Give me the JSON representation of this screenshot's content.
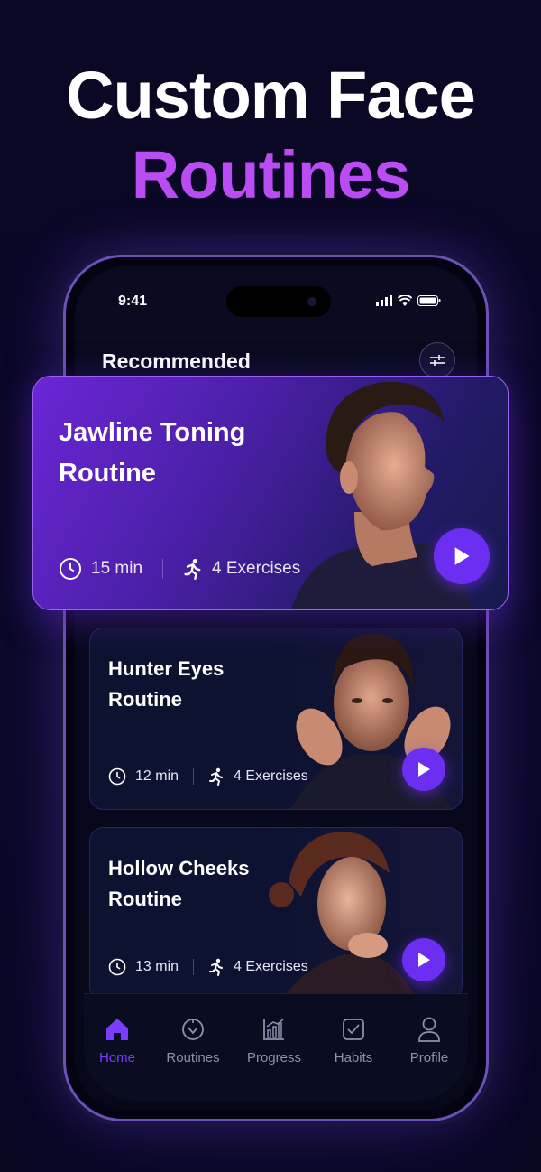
{
  "headline": {
    "line1": "Custom Face",
    "line2": "Routines"
  },
  "status_bar": {
    "time": "9:41"
  },
  "section": {
    "title": "Recommended"
  },
  "routines": [
    {
      "title": "Jawline Toning Routine",
      "duration": "15 min",
      "exercises": "4 Exercises"
    },
    {
      "title": "Hunter Eyes Routine",
      "duration": "12 min",
      "exercises": "4 Exercises"
    },
    {
      "title": "Hollow Cheeks Routine",
      "duration": "13 min",
      "exercises": "4 Exercises"
    }
  ],
  "tabs": [
    {
      "label": "Home",
      "icon": "home-icon",
      "active": true
    },
    {
      "label": "Routines",
      "icon": "routines-icon",
      "active": false
    },
    {
      "label": "Progress",
      "icon": "progress-icon",
      "active": false
    },
    {
      "label": "Habits",
      "icon": "habits-icon",
      "active": false
    },
    {
      "label": "Profile",
      "icon": "profile-icon",
      "active": false
    }
  ],
  "colors": {
    "accent": "#6c2ef0",
    "headline_accent": "#b94cf2",
    "background": "#0b0826"
  }
}
